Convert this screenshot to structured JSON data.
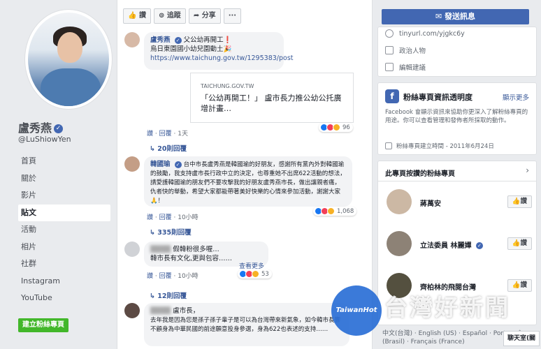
{
  "page": {
    "name": "盧秀燕",
    "handle": "@LuShiowYen",
    "nav": [
      "首頁",
      "關於",
      "影片",
      "貼文",
      "活動",
      "相片",
      "社群",
      "Instagram",
      "YouTube"
    ],
    "active_nav_index": 3,
    "create_page_label": "建立粉絲專頁"
  },
  "feed": {
    "actions": [
      "讚",
      "追蹤",
      "分享",
      "···"
    ],
    "comment1": {
      "name": "盧秀燕",
      "text1": "父公幼再開工❗",
      "text2": "烏日東園國小幼兒園動土🎉",
      "link": "https://www.taichung.gov.tw/1295383/post",
      "card_domain": "TAICHUNG.GOV.TW",
      "card_title": "「公幼再開工！」 盧市長力推公幼公托廣增計畫…",
      "meta_like": "讚",
      "meta_reply": "回覆",
      "meta_time": "1天",
      "reaction_count": "96",
      "replies": "20則回覆"
    },
    "comment2": {
      "name": "韓國瑜",
      "text": "台中市長盧秀燕是韓國瑜的好朋友，感謝所有黨內外對韓國瑜的鼓勵，我支持盧市長行政中立的決定，也尊重她不出席622活動的想法，請愛護韓國瑜的朋友們不要攻擊我的好朋友盧秀燕市長，做出讓親者痛，仇者快的舉動，希望大家都能帶著美好快樂的心情來參加活動，謝謝大家🙏！",
      "meta_like": "讚",
      "meta_reply": "回覆",
      "meta_time": "10小時",
      "reaction_count": "1,068",
      "replies": "335則回覆"
    },
    "comment3": {
      "name_blurred": "▒▒▒▒",
      "text_lead": "假韓粉很多喔…",
      "text": "韓市長有文化,更與包容……",
      "see_more": "查看更多",
      "meta_like": "讚",
      "meta_reply": "回覆",
      "meta_time": "10小時",
      "reaction_count": "53",
      "replies": "12則回覆"
    },
    "comment4": {
      "name_blurred": "▒▒▒▒",
      "text_lead": "盧市長，",
      "text": "去年我是因為您是孫子孫子輩子是可以為台灣帶來新氣象，如今韓市長響不顧身為中華民國的前途願意投身參選，身為622也表述的支持……"
    }
  },
  "sidebar": {
    "send_message": "發送訊息",
    "info_rows": [
      "tinyurl.com/yjgkc6y",
      "政治人物",
      "編輯建議"
    ],
    "transparency_title": "粉絲專頁資訊透明度",
    "transparency_more": "顯示更多",
    "transparency_text": "Facebook 會顯示資訊來協助你更深入了解粉絲專頁的用途。你可以查看管理和發佈者所採取的動作。",
    "created": "粉絲專頁建立時間 - 2011年6月24日",
    "liked_title": "此專頁按讚的粉絲專頁",
    "liked_pages": [
      {
        "name": "蔣萬安",
        "button": "讚"
      },
      {
        "name": "立法委員 林麗嬋",
        "button": "讚"
      },
      {
        "name": "齊柏林的飛閱台灣",
        "button": "讚"
      }
    ],
    "footer": "中文(台灣) · English (US) · Español · Português (Brasil) · Français (France)",
    "chat": "聊天室(關"
  },
  "watermark": {
    "circle": "TaiwanHot",
    "text": "台灣好新聞"
  },
  "colors": {
    "brand_blue": "#4267b2",
    "link_blue": "#385898",
    "green": "#42b72a"
  }
}
